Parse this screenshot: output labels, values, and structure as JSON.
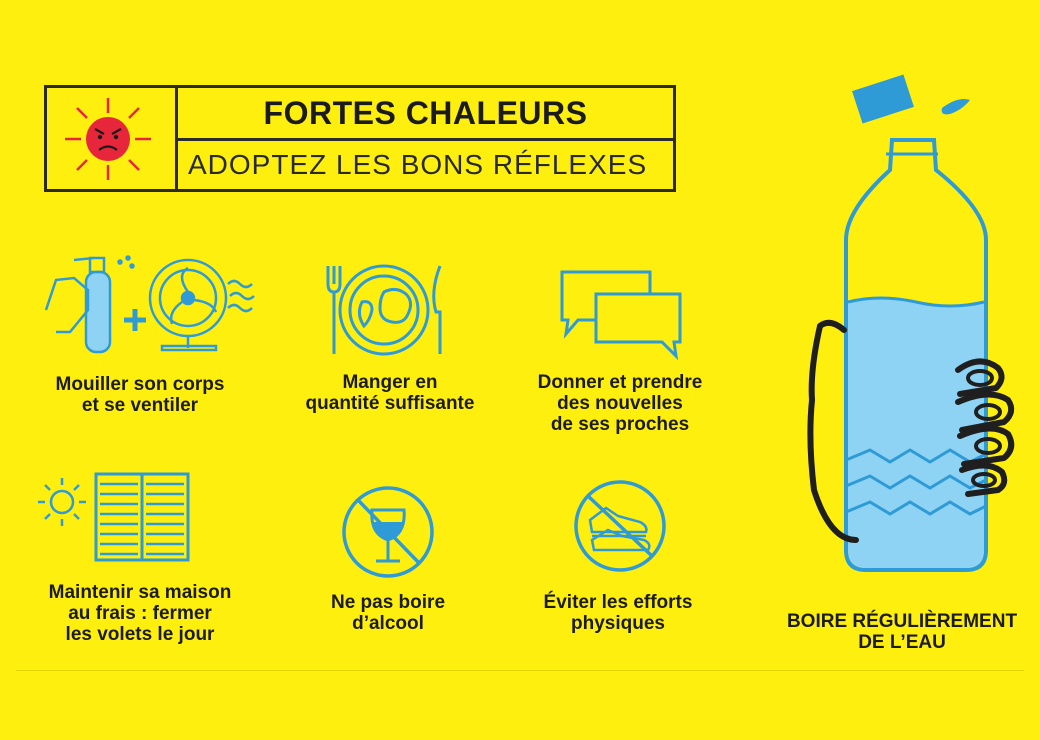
{
  "header": {
    "title": "FORTES CHALEURS",
    "subtitle": "ADOPTEZ LES BONS RÉFLEXES",
    "sun_icon": "angry-sun-icon"
  },
  "tips": [
    {
      "icon": "spray-and-fan-icon",
      "label": "Mouiller son corps\net se ventiler"
    },
    {
      "icon": "plate-fork-knife-icon",
      "label": "Manger en\nquantité suffisante"
    },
    {
      "icon": "speech-bubbles-icon",
      "label": "Donner et prendre\ndes nouvelles\nde ses proches"
    },
    {
      "icon": "sun-and-shutters-icon",
      "label": "Maintenir sa maison\nau frais : fermer\nles volets le jour"
    },
    {
      "icon": "no-wine-glass-icon",
      "label": "Ne pas boire\nd’alcool"
    },
    {
      "icon": "no-sneakers-icon",
      "label": "Éviter les efforts\nphysiques"
    }
  ],
  "bottle": {
    "icon": "water-bottle-in-hand-icon",
    "label": "BOIRE RÉGULIÈREMENT\nDE L’EAU"
  },
  "colors": {
    "background": "#FFEF0F",
    "icon_blue": "#2E9BD6",
    "water_blue": "#8FD3F4",
    "sun_red": "#E8263B",
    "text_dark": "#1c1c1c"
  }
}
